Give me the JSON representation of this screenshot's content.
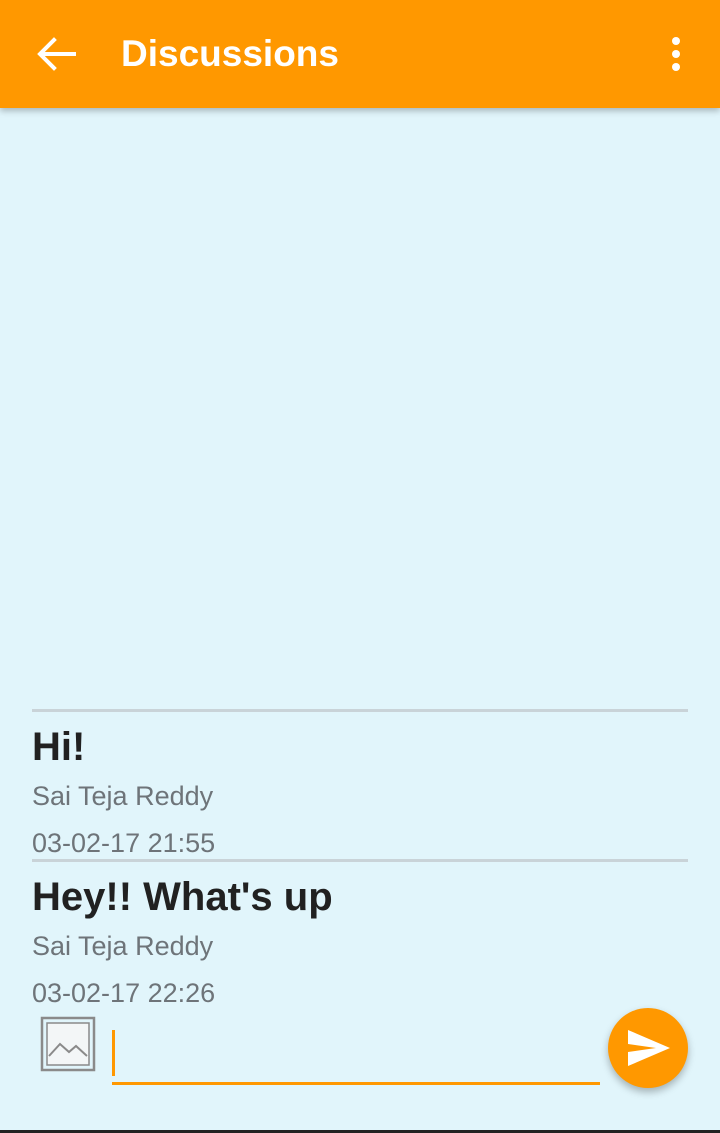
{
  "appbar": {
    "title": "Discussions",
    "back_icon": "arrow-back-icon",
    "menu_icon": "more-vert-icon",
    "color": "#FF9800"
  },
  "messages": [
    {
      "text": "Hi!",
      "author": "Sai Teja Reddy",
      "timestamp": "03-02-17  21:55"
    },
    {
      "text": "Hey!! What's up",
      "author": "Sai Teja Reddy",
      "timestamp": "03-02-17  22:26"
    }
  ],
  "composer": {
    "image_icon": "image-icon",
    "input_value": "",
    "send_icon": "send-icon"
  },
  "colors": {
    "background": "#E1F5FB",
    "accent": "#FF9800"
  }
}
